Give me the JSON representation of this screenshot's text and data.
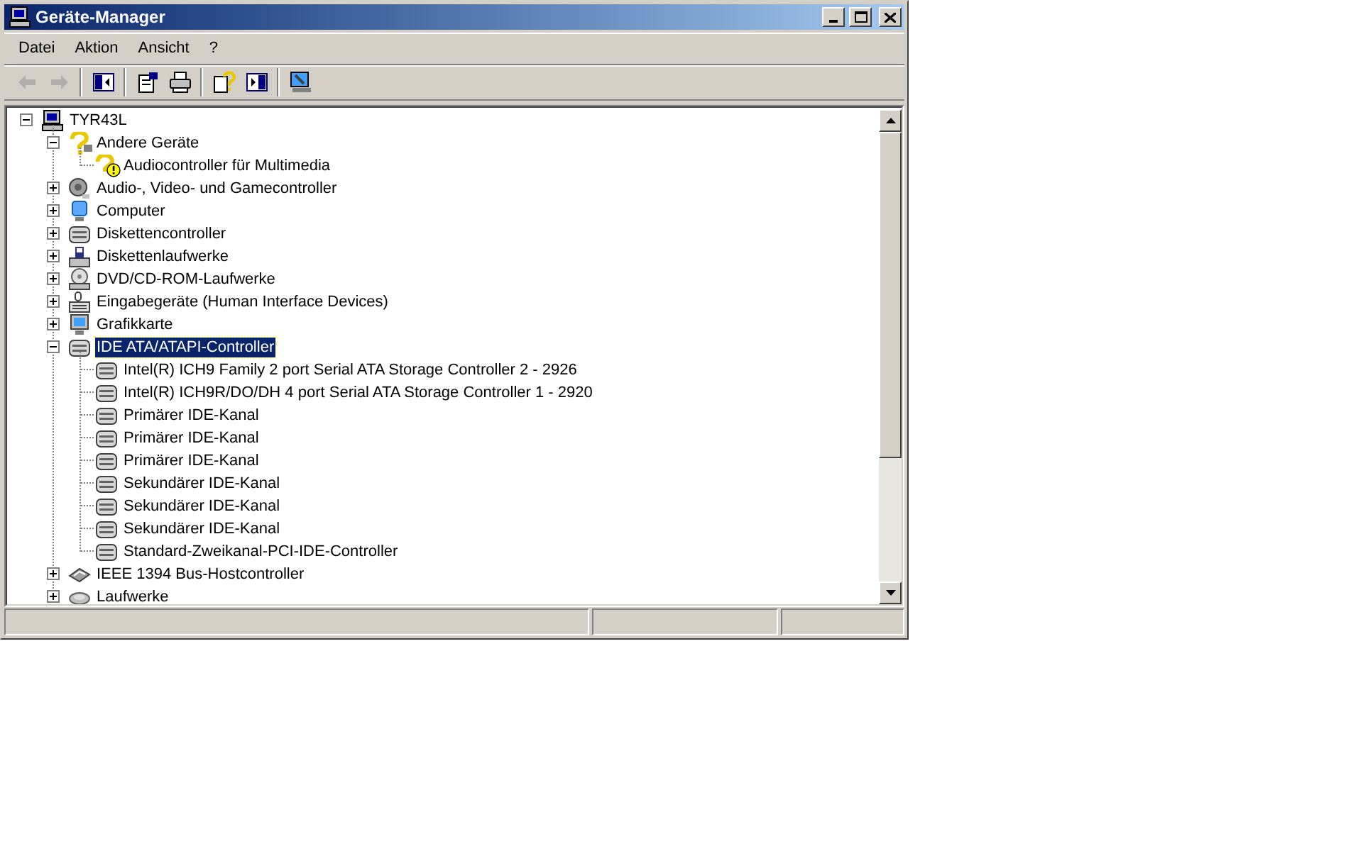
{
  "window": {
    "title": "Geräte-Manager"
  },
  "menu": [
    {
      "label": "Datei"
    },
    {
      "label": "Aktion"
    },
    {
      "label": "Ansicht"
    },
    {
      "label": "?"
    }
  ],
  "toolbar": [
    [
      {
        "disabled": true
      },
      {
        "disabled": true
      }
    ],
    [
      {
        "disabled": false
      }
    ],
    [
      {
        "disabled": false
      },
      {
        "disabled": false
      }
    ],
    [
      {
        "disabled": false
      },
      {
        "disabled": false
      }
    ],
    [
      {
        "disabled": false
      }
    ]
  ],
  "tree": [
    {
      "label": "TYR43L",
      "kind": "host",
      "selected": false,
      "expanded": true,
      "children": [
        {
          "label": "Andere Geräte",
          "kind": "unknown",
          "selected": false,
          "expanded": true,
          "children": [
            {
              "label": "Audiocontroller für Multimedia",
              "kind": "warning",
              "selected": false
            }
          ]
        },
        {
          "label": "Audio-, Video- und Gamecontroller",
          "kind": "audio",
          "selected": false,
          "expanded": false
        },
        {
          "label": "Computer",
          "kind": "computer",
          "selected": false,
          "expanded": false
        },
        {
          "label": "Diskettencontroller",
          "kind": "controller",
          "selected": false,
          "expanded": false
        },
        {
          "label": "Diskettenlaufwerke",
          "kind": "floppy",
          "selected": false,
          "expanded": false
        },
        {
          "label": "DVD/CD-ROM-Laufwerke",
          "kind": "disc",
          "selected": false,
          "expanded": false
        },
        {
          "label": "Eingabegeräte (Human Interface Devices)",
          "kind": "input",
          "selected": false,
          "expanded": false
        },
        {
          "label": "Grafikkarte",
          "kind": "display",
          "selected": false,
          "expanded": false
        },
        {
          "label": "IDE ATA/ATAPI-Controller",
          "kind": "controller",
          "selected": true,
          "expanded": true,
          "children": [
            {
              "label": "Intel(R) ICH9 Family 2 port Serial ATA Storage Controller 2 - 2926",
              "kind": "controller",
              "selected": false
            },
            {
              "label": "Intel(R) ICH9R/DO/DH 4 port Serial ATA Storage Controller 1 - 2920",
              "kind": "controller",
              "selected": false
            },
            {
              "label": "Primärer IDE-Kanal",
              "kind": "controller",
              "selected": false
            },
            {
              "label": "Primärer IDE-Kanal",
              "kind": "controller",
              "selected": false
            },
            {
              "label": "Primärer IDE-Kanal",
              "kind": "controller",
              "selected": false
            },
            {
              "label": "Sekundärer IDE-Kanal",
              "kind": "controller",
              "selected": false
            },
            {
              "label": "Sekundärer IDE-Kanal",
              "kind": "controller",
              "selected": false
            },
            {
              "label": "Sekundärer IDE-Kanal",
              "kind": "controller",
              "selected": false
            },
            {
              "label": "Standard-Zweikanal-PCI-IDE-Controller",
              "kind": "controller",
              "selected": false
            }
          ]
        },
        {
          "label": "IEEE 1394 Bus-Hostcontroller",
          "kind": "bus",
          "selected": false,
          "expanded": false
        },
        {
          "label": "Laufwerke",
          "kind": "drive",
          "selected": false,
          "expanded": false
        }
      ]
    }
  ]
}
